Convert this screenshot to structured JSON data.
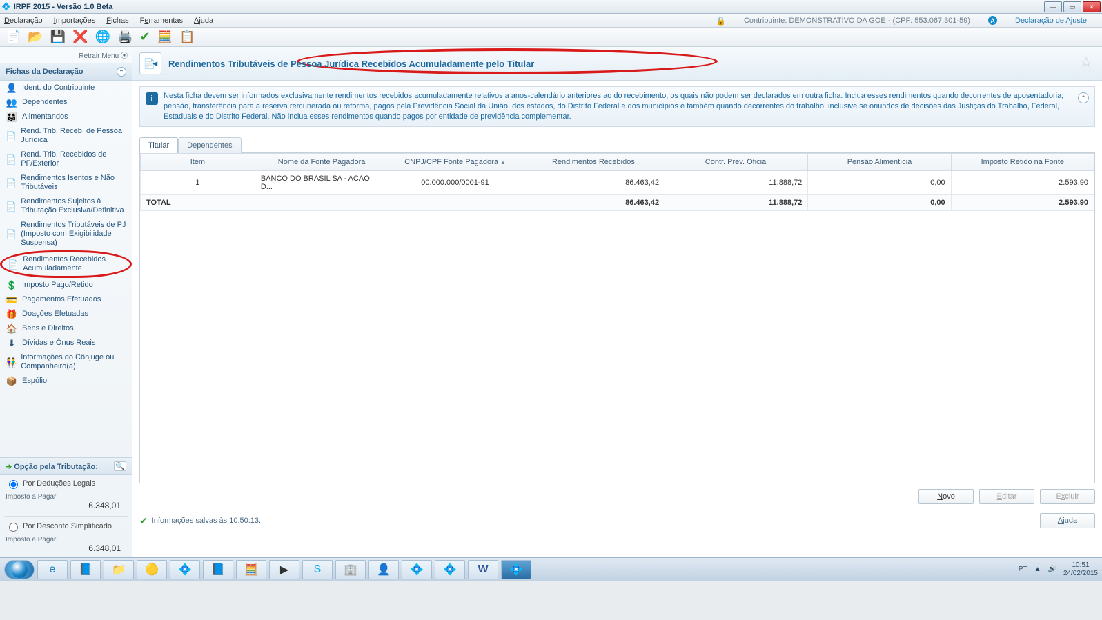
{
  "window": {
    "title": "IRPF 2015 - Versão 1.0 Beta"
  },
  "menubar": {
    "items": [
      "Declaração",
      "Importações",
      "Fichas",
      "Ferramentas",
      "Ajuda"
    ],
    "contributor": "Contribuinte: DEMONSTRATIVO DA GOE - (CPF: 553.067.301-59)",
    "decl_type": "Declaração de Ajuste"
  },
  "sidebar": {
    "retrair": "Retrair Menu",
    "section_title": "Fichas da Declaração",
    "items": [
      {
        "icon": "👤",
        "label": "Ident. do Contribuinte"
      },
      {
        "icon": "👥",
        "label": "Dependentes"
      },
      {
        "icon": "👨‍👩‍👧",
        "label": "Alimentandos"
      },
      {
        "icon": "📄",
        "label": "Rend. Trib. Receb. de Pessoa Jurídica"
      },
      {
        "icon": "📄",
        "label": "Rend. Trib. Recebidos de PF/Exterior"
      },
      {
        "icon": "📄",
        "label": "Rendimentos Isentos e Não Tributáveis"
      },
      {
        "icon": "📄",
        "label": "Rendimentos Sujeitos à Tributação Exclusiva/Definitiva"
      },
      {
        "icon": "📄",
        "label": "Rendimentos Tributáveis de PJ (Imposto com Exigibilidade Suspensa)"
      },
      {
        "icon": "📄",
        "label": "Rendimentos Recebidos Acumuladamente"
      },
      {
        "icon": "💲",
        "label": "Imposto Pago/Retido"
      },
      {
        "icon": "💳",
        "label": "Pagamentos Efetuados"
      },
      {
        "icon": "🎁",
        "label": "Doações Efetuadas"
      },
      {
        "icon": "🏠",
        "label": "Bens e Direitos"
      },
      {
        "icon": "⬇",
        "label": "Dívidas e Ônus Reais"
      },
      {
        "icon": "👫",
        "label": "Informações do Cônjuge ou Companheiro(a)"
      },
      {
        "icon": "📦",
        "label": "Espólio"
      }
    ],
    "opcao_title": "Opção pela Tributação:",
    "radio1": "Por Deduções Legais",
    "radio2": "Por Desconto Simplificado",
    "imp_label": "Imposto a Pagar",
    "imp_val1": "6.348,01",
    "imp_val2": "6.348,01"
  },
  "header": {
    "title": "Rendimentos Tributáveis de Pessoa Jurídica Recebidos Acumuladamente pelo Titular"
  },
  "info": {
    "text": "Nesta ficha devem ser informados exclusivamente rendimentos recebidos acumuladamente relativos a anos-calendário anteriores ao do recebimento, os quais não podem ser declarados em outra ficha. Inclua esses rendimentos quando decorrentes de aposentadoria, pensão, transferência para a reserva remunerada ou reforma, pagos pela Previdência Social da União, dos estados, do Distrito Federal e dos municípios e também quando decorrentes do trabalho, inclusive se oriundos de decisões das Justiças do Trabalho, Federal, Estaduais e do Distrito Federal. Não inclua esses rendimentos quando pagos por entidade de previdência complementar."
  },
  "tabs": {
    "t1": "Titular",
    "t2": "Dependentes"
  },
  "table": {
    "headers": {
      "item": "Item",
      "fonte": "Nome da Fonte Pagadora",
      "cnpj": "CNPJ/CPF Fonte Pagadora",
      "rend": "Rendimentos Recebidos",
      "contr": "Contr. Prev. Oficial",
      "pensao": "Pensão Alimentícia",
      "imp": "Imposto Retido na Fonte"
    },
    "row": {
      "item": "1",
      "fonte": "BANCO DO BRASIL SA - ACAO D...",
      "cnpj": "00.000.000/0001-91",
      "rend": "86.463,42",
      "contr": "11.888,72",
      "pensao": "0,00",
      "imp": "2.593,90"
    },
    "total_label": "TOTAL",
    "total": {
      "rend": "86.463,42",
      "contr": "11.888,72",
      "pensao": "0,00",
      "imp": "2.593,90"
    }
  },
  "buttons": {
    "novo": "Novo",
    "editar": "Editar",
    "excluir": "Excluir",
    "ajuda": "Ajuda"
  },
  "status": {
    "text": "Informações salvas às 10:50:13."
  },
  "tray": {
    "lang": "PT",
    "time": "10:51",
    "date": "24/02/2015"
  }
}
